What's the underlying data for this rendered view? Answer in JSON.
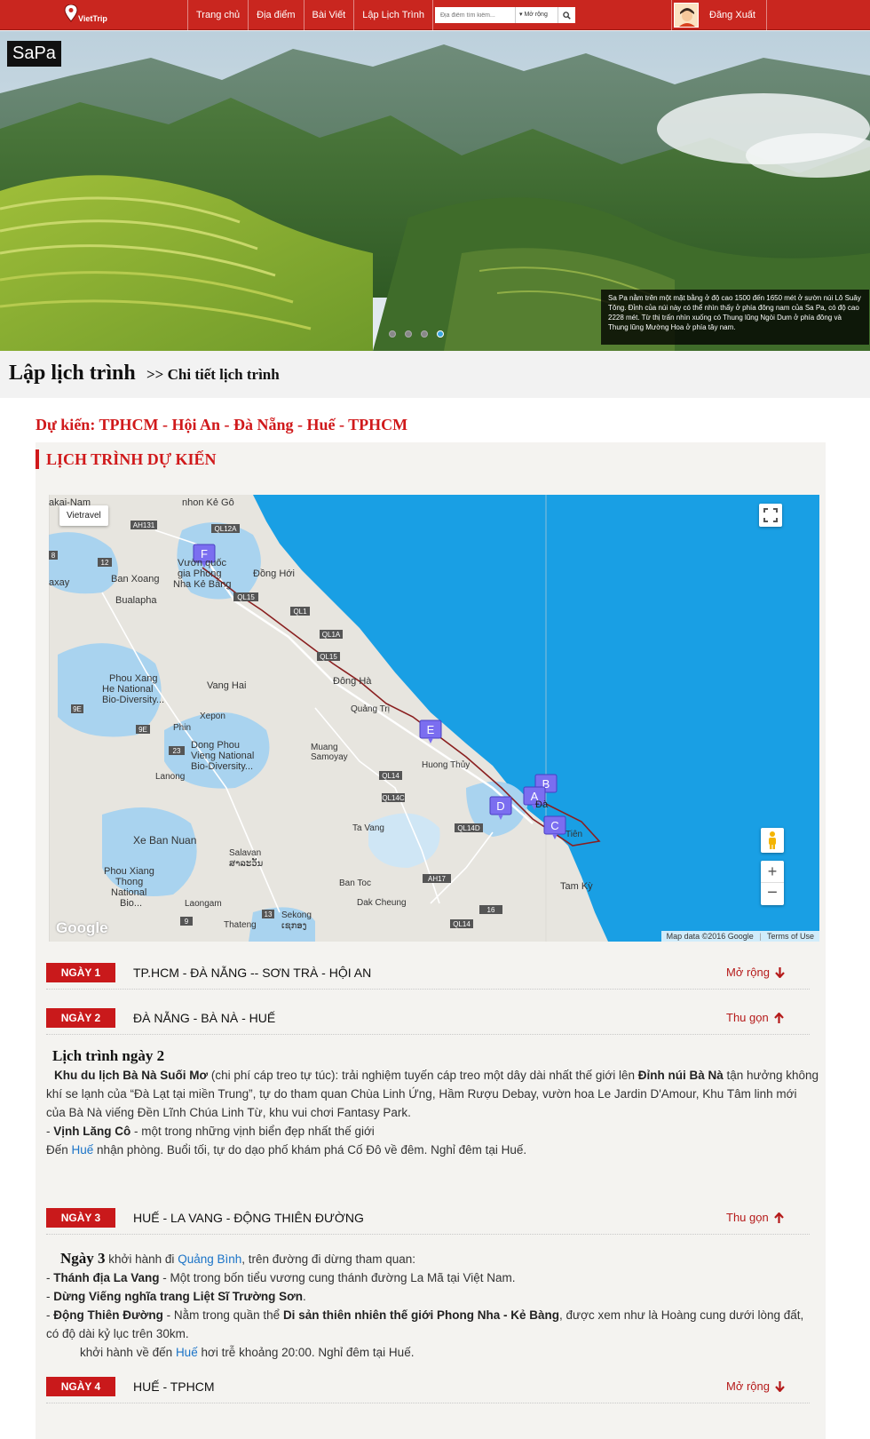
{
  "nav": {
    "logo_text": "VietTrip",
    "links": [
      "Trang chủ",
      "Địa điểm",
      "Bài Viết",
      "Lập Lịch Trình"
    ],
    "search_placeholder": "Địa điểm tìm kiếm...",
    "search_expand": "Mở rộng",
    "logout": "Đăng Xuất"
  },
  "hero": {
    "title": "SaPa",
    "caption": "Sa Pa nằm trên một mặt bằng ở độ cao 1500 đến 1650 mét ở sườn núi Lô Suây Tông. Đỉnh của núi này có thể nhìn thấy ở phía đông nam của Sa Pa, có độ cao 2228 mét. Từ thị trấn nhìn xuống có Thung lũng Ngòi Dum ở phía đông và Thung lũng Mường Hoa ở phía tây nam.",
    "slide_count": 4,
    "active_slide": 4
  },
  "breadcrumb": {
    "main": "Lập lịch trình",
    "sub": ">> Chi tiết lịch trình"
  },
  "expected": "Dự kiến: TPHCM - Hội An - Đà Nẵng - Huế - TPHCM",
  "section_title": "LỊCH TRÌNH DỰ KIẾN",
  "map": {
    "chip": "Vietravel",
    "attribution": "Map data ©2016 Google",
    "terms": "Terms of Use",
    "google": "Google",
    "place_labels": [
      "Vườn quốc gia Phong Nha Kẻ Bàng",
      "Đồng Hới",
      "Ban Xoang",
      "Bualapha",
      "Phou Xang He National Bio-Diversity...",
      "Vang Hai",
      "Đông Hà",
      "Quảng Trị",
      "Xepon",
      "Phin",
      "Dong Phou Vieng National Bio-Diversity...",
      "Muang Samoyay",
      "Lanong",
      "Huong Thủy",
      "Ta Vang",
      "Xe Ban Nuan",
      "Salavan",
      "ສາລະວັນ",
      "Phou Xiang Thong National Bio...",
      "Ban Toc",
      "Dak Cheung",
      "Laongam",
      "Thateng",
      "Sekong",
      "ເຊກອງ",
      "Tam Kỳ",
      "Đà Nẵng",
      "Hội An",
      "Tiên",
      "nhon Kẻ Gô",
      "akai-Nam",
      "axay"
    ],
    "road_labels": [
      "AH131",
      "QL12A",
      "12",
      "8",
      "QL15",
      "QL1",
      "QL1A",
      "QL15",
      "9E",
      "23",
      "9E",
      "QL49",
      "QL14",
      "QL14C",
      "QL14D",
      "AH17",
      "QL14",
      "16",
      "13",
      "9"
    ],
    "markers": [
      "F",
      "E",
      "D",
      "A",
      "B",
      "C"
    ]
  },
  "days": [
    {
      "badge": "NGÀY 1",
      "title": "TP.HCM - ĐÀ NẴNG -- SƠN TRÀ - HỘI AN",
      "toggle": "Mở rộng"
    },
    {
      "badge": "NGÀY 2",
      "title": "ĐÀ NẴNG - BÀ NÀ - HUẾ",
      "toggle": "Thu gọn"
    },
    {
      "badge": "NGÀY 3",
      "title": "HUẾ - LA VANG - ĐỘNG THIÊN ĐƯỜNG",
      "toggle": "Thu gọn"
    },
    {
      "badge": "NGÀY 4",
      "title": "HUẾ - TPHCM",
      "toggle": "Mở rộng"
    }
  ],
  "day2": {
    "heading": "Lịch trình ngày 2",
    "p1_a": "Khu ",
    "p1_link": "du lịch Bà Nà",
    "p1_b": " Suối Mơ",
    "p1_c": " (chi phí cáp treo tự túc): trải nghiệm tuyến cáp treo một dây dài nhất thế giới lên ",
    "p1_d": "Đỉnh núi Bà Nà",
    "p1_e": " tận hưởng không khí se lạnh của “Đà Lạt tại miền Trung”, tự do tham quan Chùa Linh Ứng, Hầm Rượu Debay, vườn hoa Le Jardin D'Amour, Khu Tâm linh mới của Bà Nà viếng Đền Lĩnh Chúa Linh Từ, khu vui chơi Fantasy Park.",
    "p2_a": "- ",
    "p2_b": "Vịnh Lăng Cô",
    "p2_c": " - một trong những vịnh biển đẹp nhất thế giới",
    "p3_a": "Đến ",
    "p3_link": "Huế",
    "p3_b": " nhận phòng. Buổi tối, tự do dạo phố khám phá Cố Đô về đêm. Nghỉ đêm tại Huế."
  },
  "day3": {
    "heading": "Ngày 3",
    "p1_a": " khởi hành đi ",
    "p1_link": "Quảng Bình",
    "p1_b": ", trên đường đi dừng tham quan:",
    "p2_b": "Thánh địa La Vang",
    "p2_c": " - Một trong bốn tiểu vương cung thánh đường La Mã tại Việt Nam.",
    "p3_b": "Dừng Viếng nghĩa trang Liệt Sĩ Trường Sơn",
    "p3_c": ".",
    "p4_link": "Động Thiên Đường",
    "p4_c": " - Nằm trong quần thể ",
    "p4_d": "Di sản thiên nhiên thế giới Phong Nha - Kẻ Bàng",
    "p4_e": ", được xem như là Hoàng cung dưới lòng đất, có độ dài kỷ lục trên 30km.",
    "p5_a": "khởi hành về đến ",
    "p5_link": "Huế",
    "p5_b": " hơi trễ khoảng 20:00. Nghỉ đêm tại Huế."
  },
  "colors": {
    "brand": "#c9261f",
    "accent": "#d0191b",
    "link": "#1a73c7",
    "sea": "#199fe4"
  }
}
